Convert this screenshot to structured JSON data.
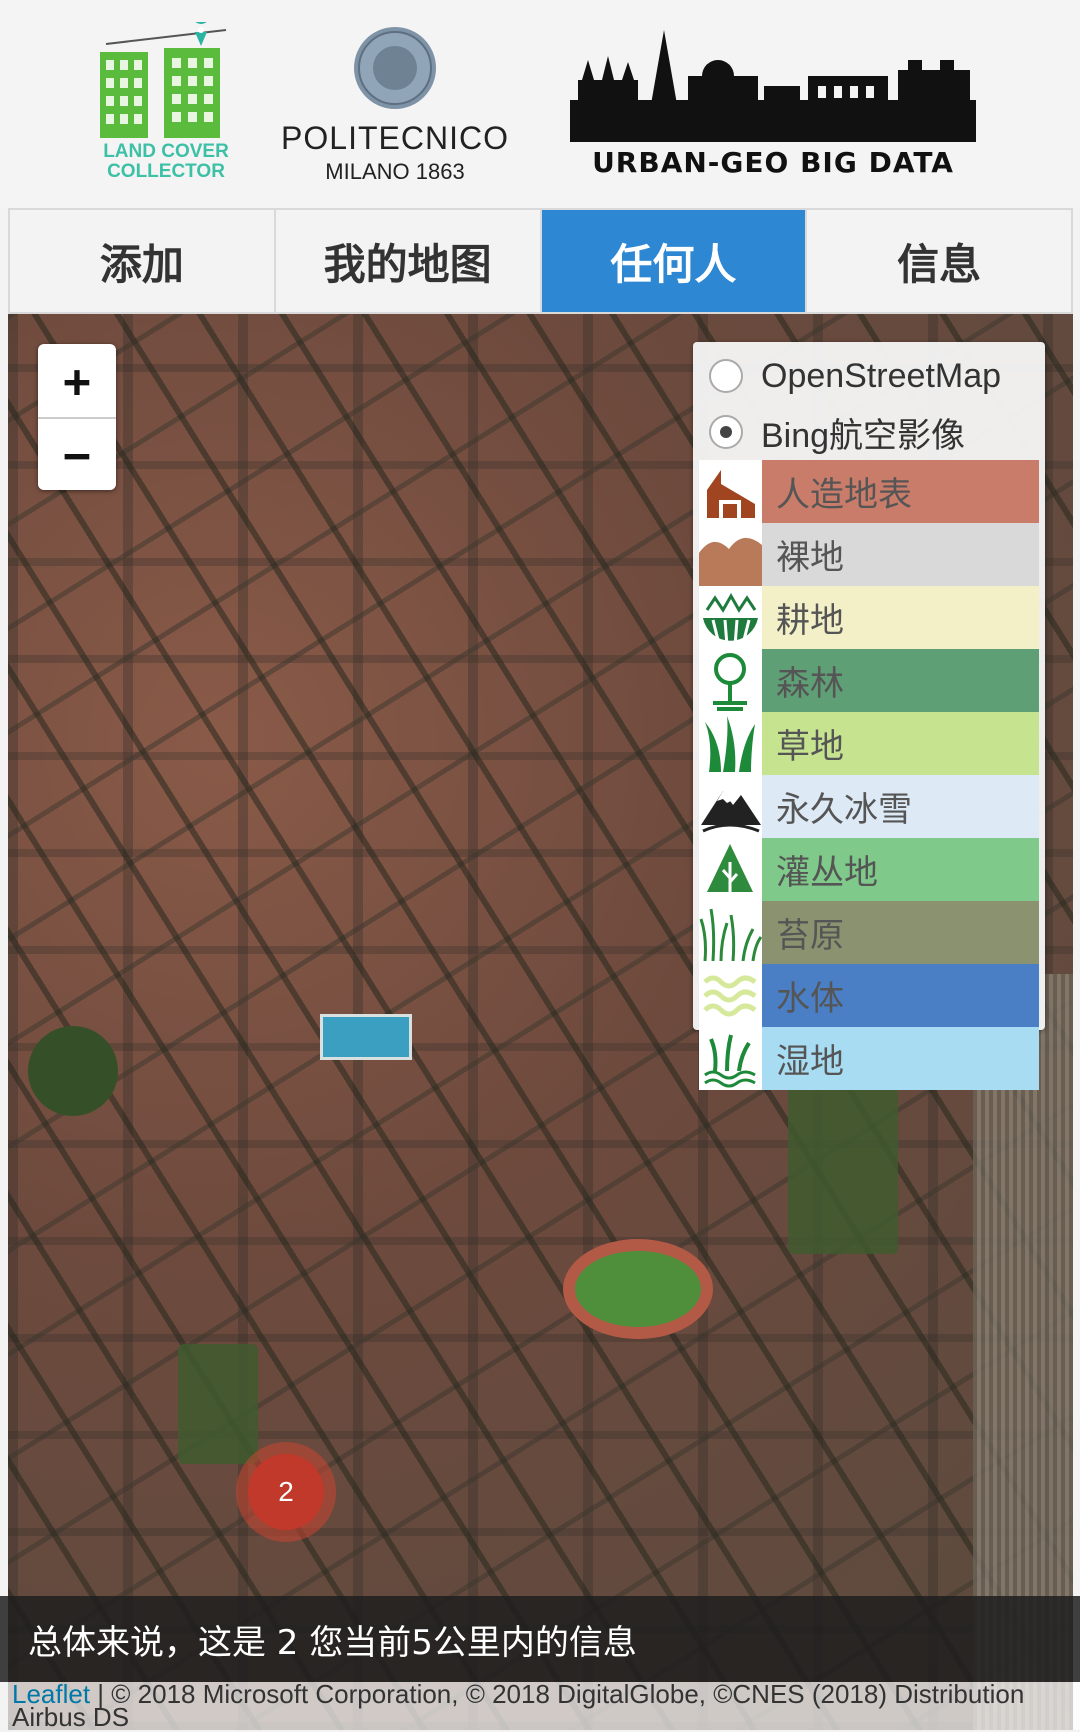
{
  "header": {
    "lcc_logo_line1": "LAND COVER",
    "lcc_logo_line2": "COLLECTOR",
    "poli_name": "POLITECNICO",
    "poli_sub": "MILANO 1863",
    "urban_title": "URBAN-GEO BIG DATA"
  },
  "tabs": [
    {
      "label": "添加",
      "active": false
    },
    {
      "label": "我的地图",
      "active": false
    },
    {
      "label": "任何人",
      "active": true
    },
    {
      "label": "信息",
      "active": false
    }
  ],
  "map": {
    "zoom_in": "+",
    "zoom_out": "−",
    "base_layers": [
      {
        "label": "OpenStreetMap",
        "checked": false
      },
      {
        "label": "Bing航空影像",
        "checked": true
      }
    ],
    "land_cover": [
      {
        "label": "人造地表",
        "color": "#c97c6a",
        "icon": "building-icon"
      },
      {
        "label": "裸地",
        "color": "#d9d9d9",
        "icon": "hills-icon"
      },
      {
        "label": "耕地",
        "color": "#f3f0c8",
        "icon": "field-icon"
      },
      {
        "label": "森林",
        "color": "#5f9f76",
        "icon": "tree-icon"
      },
      {
        "label": "草地",
        "color": "#c6e390",
        "icon": "grass-icon"
      },
      {
        "label": "永久冰雪",
        "color": "#dde9f4",
        "icon": "mountain-icon"
      },
      {
        "label": "灌丛地",
        "color": "#7fca8a",
        "icon": "shrub-icon"
      },
      {
        "label": "苔原",
        "color": "#8a9270",
        "icon": "tundra-icon"
      },
      {
        "label": "水体",
        "color": "#4a7fc6",
        "icon": "water-icon"
      },
      {
        "label": "湿地",
        "color": "#a7dcf2",
        "icon": "wetland-icon"
      }
    ],
    "cluster_count": "2"
  },
  "info_bar": "总体来说，这是 2 您当前5公里内的信息",
  "attribution": {
    "leaflet": "Leaflet",
    "text": " | © 2018 Microsoft Corporation, © 2018 DigitalGlobe, ©CNES (2018) Distribution Airbus DS"
  }
}
